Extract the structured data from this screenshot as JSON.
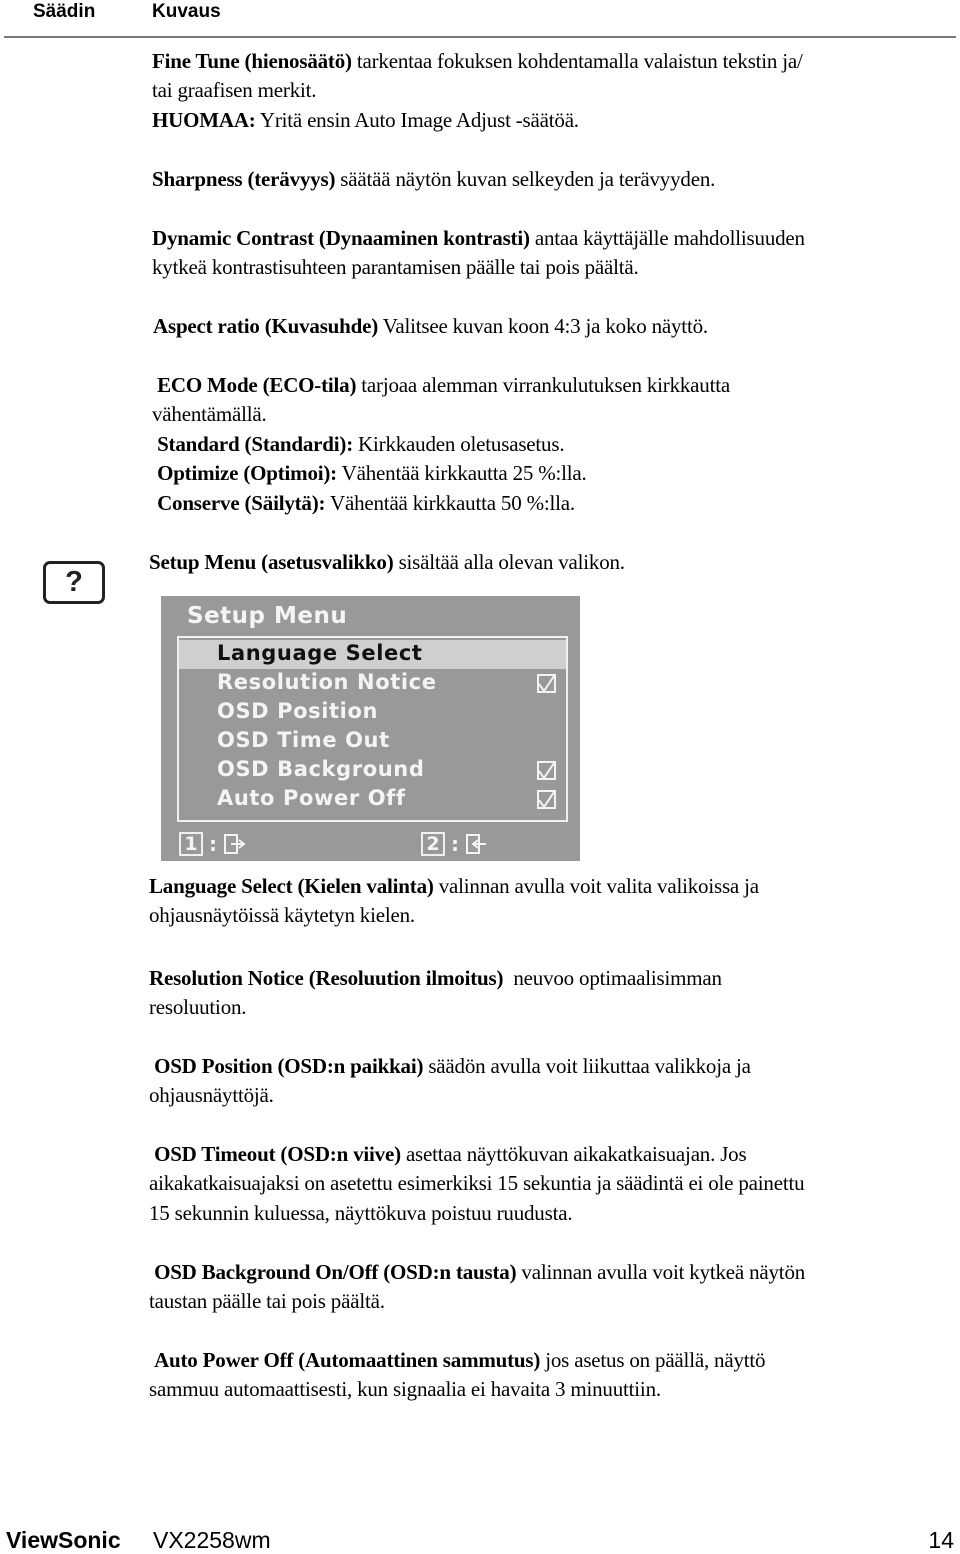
{
  "header": {
    "col_control": "Säädin",
    "col_description": "Kuvaus"
  },
  "paragraphs": {
    "fine_tune": {
      "bold": "Fine Tune (hienosäätö)",
      "line1_rest": " tarkentaa fokuksen kohdentamalla valaistun tekstin ja/",
      "line2": "tai graafisen merkit.",
      "note_bold": "HUOMAA:",
      "note_rest": " Yritä ensin Auto Image Adjust -säätöä."
    },
    "sharpness": {
      "bold": "Sharpness (terävyys)",
      "rest": " säätää näytön kuvan selkeyden ja terävyyden."
    },
    "dynamic_contrast": {
      "bold": "Dynamic Contrast (Dynaaminen kontrasti)",
      "line1_rest": " antaa käyttäjälle mahdollisuuden",
      "line2": "kytkeä kontrastisuhteen parantamisen päälle tai pois päältä."
    },
    "aspect_ratio": {
      "bold": "Aspect ratio (Kuvasuhde)",
      "rest": " Valitsee kuvan koon 4:3 ja koko näyttö."
    },
    "eco_mode": {
      "bold": "ECO Mode (ECO-tila)",
      "line1_rest": " tarjoaa alemman virrankulutuksen kirkkautta",
      "line2": "vähentämällä.",
      "standard_bold": "Standard (Standardi):",
      "standard_rest": " Kirkkauden oletusasetus.",
      "optimize_bold": "Optimize (Optimoi):",
      "optimize_rest": " Vähentää kirkkautta 25 %:lla.",
      "conserve_bold": "Conserve (Säilytä):",
      "conserve_rest": " Vähentää kirkkautta 50 %:lla."
    },
    "setup_menu": {
      "bold": "Setup Menu (asetusvalikko)",
      "rest": " sisältää alla olevan valikon."
    },
    "language_select": {
      "bold": "Language Select (Kielen valinta)",
      "line1_rest": " valinnan avulla voit valita valikoissa ja",
      "line2": "ohjausnäytöissä käytetyn kielen."
    },
    "resolution_notice": {
      "bold": "Resolution Notice (Resoluution ilmoitus)",
      "line1_rest": "  neuvoo optimaalisimman",
      "line2": "resoluution."
    },
    "osd_position": {
      "bold": "OSD Position (OSD:n paikkai)",
      "line1_rest": " säädön avulla voit liikuttaa valikkoja ja",
      "line2": "ohjausnäyttöjä."
    },
    "osd_timeout": {
      "bold": "OSD Timeout (OSD:n viive)",
      "line1_rest": " asettaa näyttökuvan aikakatkaisuajan. Jos",
      "line2": "aikakatkaisuajaksi on asetettu esimerkiksi 15 sekuntia ja säädintä ei ole painettu",
      "line3": "15 sekunnin kuluessa, näyttökuva poistuu ruudusta."
    },
    "osd_background": {
      "bold": "OSD Background On/Off (OSD:n tausta)",
      "line1_rest": " valinnan avulla voit kytkeä näytön",
      "line2": "taustan päälle tai pois päältä."
    },
    "auto_power_off": {
      "bold": "Auto Power Off (Automaattinen sammutus)",
      "line1_rest": " jos asetus on päällä, näyttö",
      "line2": "sammuu automaattisesti, kun signaalia ei havaita 3 minuuttiin."
    }
  },
  "help_icon": {
    "glyph": "?"
  },
  "osd_menu": {
    "title": "Setup Menu",
    "items": [
      {
        "label": "Language Select",
        "selected": true,
        "checkbox": false
      },
      {
        "label": "Resolution Notice",
        "selected": false,
        "checkbox": true
      },
      {
        "label": "OSD Position",
        "selected": false,
        "checkbox": false
      },
      {
        "label": "OSD Time Out",
        "selected": false,
        "checkbox": false
      },
      {
        "label": "OSD Background",
        "selected": false,
        "checkbox": true
      },
      {
        "label": "Auto Power Off",
        "selected": false,
        "checkbox": true
      }
    ],
    "footer": [
      {
        "key": "1",
        "sep": ":",
        "icon": "exit-door-icon"
      },
      {
        "key": "2",
        "sep": ":",
        "icon": "enter-door-icon"
      }
    ],
    "colors": {
      "background": "#999999",
      "selected": "#cfcfcf",
      "text": "#f4f4f4"
    }
  },
  "footer": {
    "brand": "ViewSonic",
    "model": "VX2258wm",
    "page_number": "14"
  }
}
